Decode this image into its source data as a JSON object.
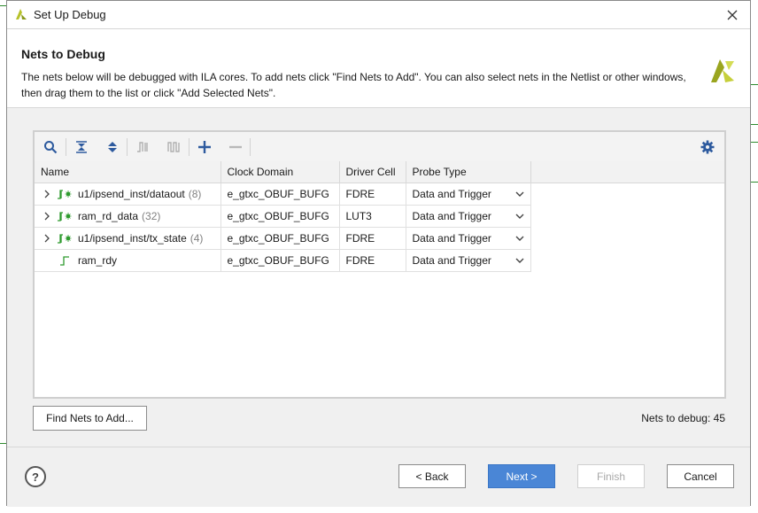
{
  "window": {
    "title": "Set Up Debug"
  },
  "header": {
    "heading": "Nets to Debug",
    "description": "The nets below will be debugged with ILA cores. To add nets click \"Find Nets to Add\". You can also select nets in the Netlist or other windows, then drag them to the list or click \"Add Selected Nets\"."
  },
  "table": {
    "columns": [
      "Name",
      "Clock Domain",
      "Driver Cell",
      "Probe Type"
    ],
    "rows": [
      {
        "name": "u1/ipsend_inst/dataout",
        "count": "(8)",
        "clock": "e_gtxc_OBUF_BUFG",
        "driver": "FDRE",
        "probe": "Data and Trigger",
        "expandable": true
      },
      {
        "name": "ram_rd_data",
        "count": "(32)",
        "clock": "e_gtxc_OBUF_BUFG",
        "driver": "LUT3",
        "probe": "Data and Trigger",
        "expandable": true
      },
      {
        "name": "u1/ipsend_inst/tx_state",
        "count": "(4)",
        "clock": "e_gtxc_OBUF_BUFG",
        "driver": "FDRE",
        "probe": "Data and Trigger",
        "expandable": true
      },
      {
        "name": "ram_rdy",
        "count": "",
        "clock": "e_gtxc_OBUF_BUFG",
        "driver": "FDRE",
        "probe": "Data and Trigger",
        "expandable": false
      }
    ]
  },
  "buttons": {
    "find_nets": "Find Nets to Add...",
    "back": "< Back",
    "next": "Next >",
    "finish": "Finish",
    "cancel": "Cancel",
    "help": "?"
  },
  "status": {
    "nets_to_debug": "Nets to debug: 45"
  },
  "colors": {
    "accent": "#4a86d6",
    "icon_blue": "#2d5a9e",
    "net_green": "#2e9a2e",
    "logo_yellow": "#b7c22a"
  }
}
